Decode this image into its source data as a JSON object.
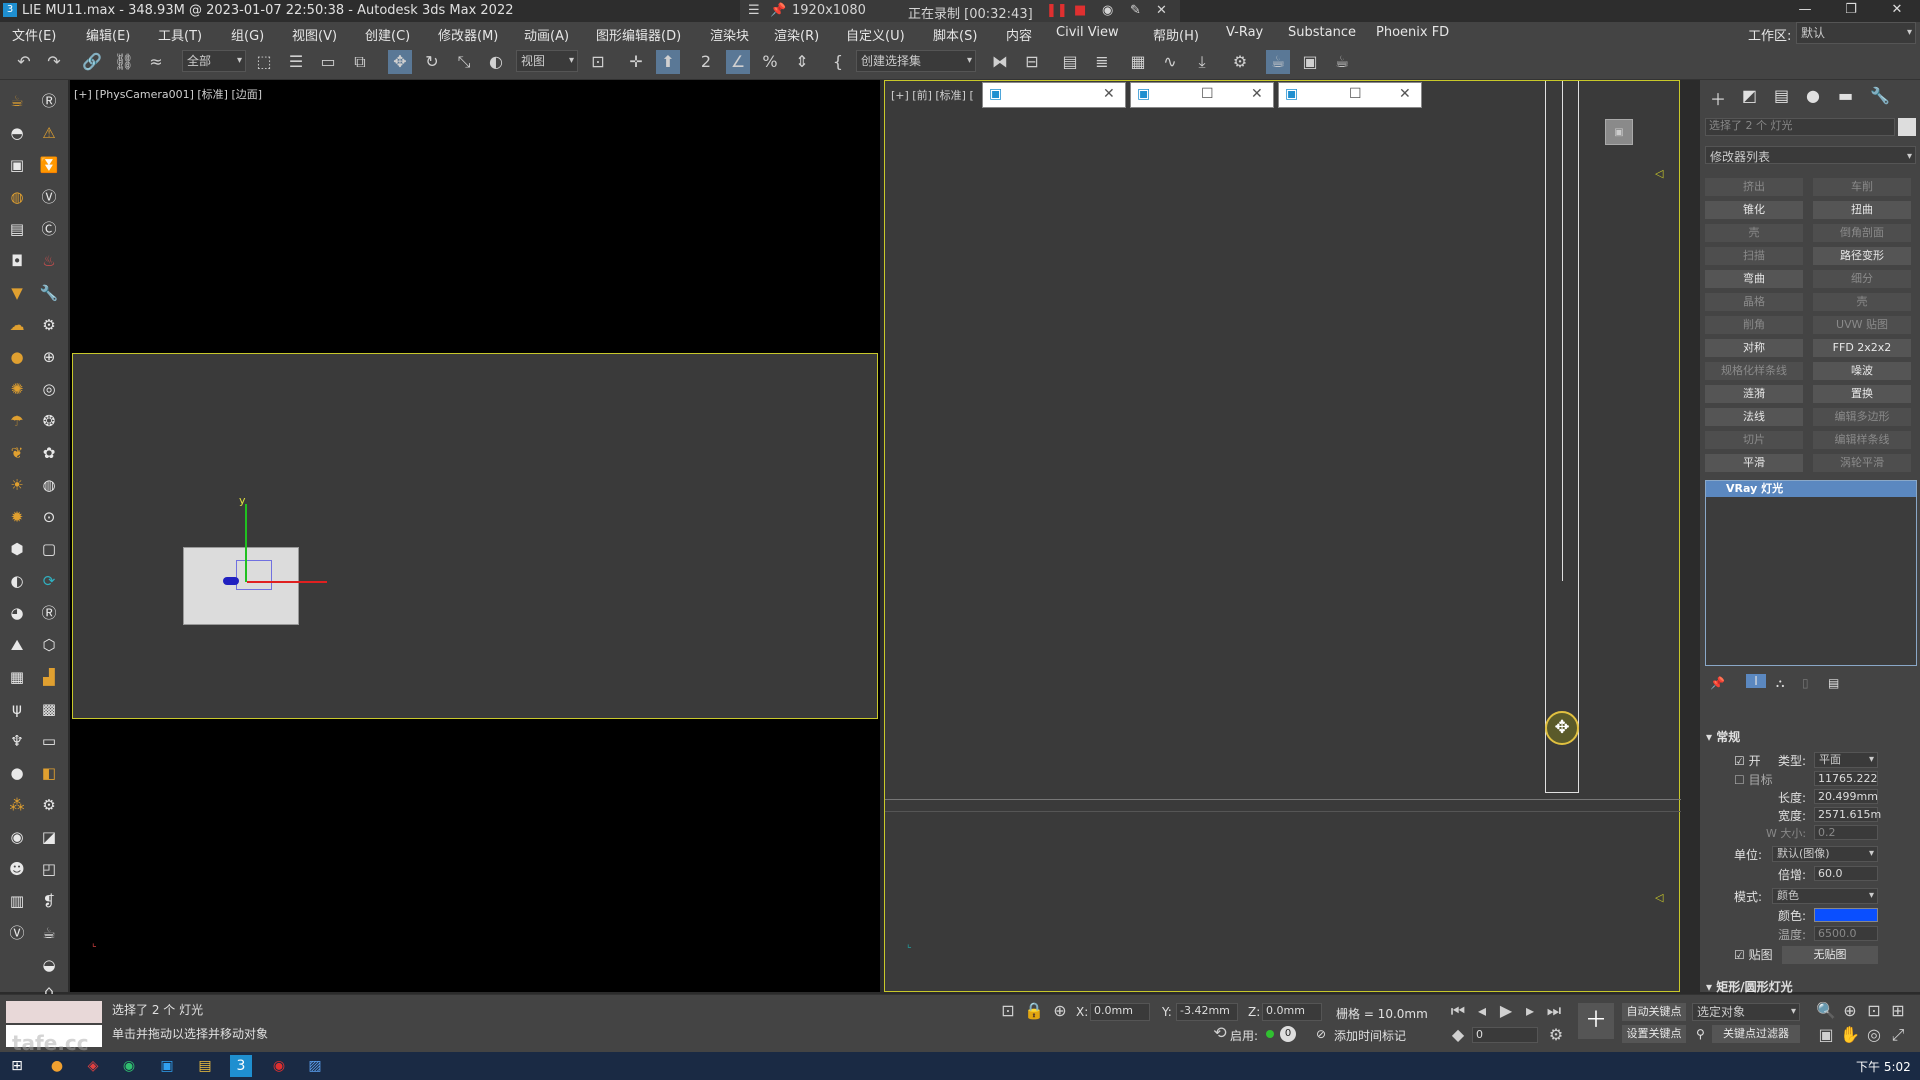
{
  "title": "LIE MU11.max - 348.93M @ 2023-01-07 22:50:38 - Autodesk 3ds Max 2022",
  "recorder": {
    "resolution": "1920x1080",
    "status": "正在录制 [00:32:43]"
  },
  "menu": [
    "文件(E)",
    "编辑(E)",
    "工具(T)",
    "组(G)",
    "视图(V)",
    "创建(C)",
    "修改器(M)",
    "动画(A)",
    "图形编辑器(D)",
    "渲染块",
    "渲染(R)",
    "自定义(U)",
    "脚本(S)",
    "内容",
    "Civil View",
    "帮助(H)",
    "V-Ray",
    "Substance",
    "Phoenix FD"
  ],
  "workspace": {
    "label": "工作区:",
    "value": "默认"
  },
  "toolbar": {
    "filter": "全部",
    "refcoord": "视图",
    "selset": "创建选择集"
  },
  "viewport_left": {
    "label": "[+] [PhysCamera001] [标准] [边面]"
  },
  "viewport_right": {
    "label": "[+] [前] [标准] ["
  },
  "cmd": {
    "selection_name": "选择了 2 个 灯光",
    "modifier_list": "修改器列表",
    "modifiers": [
      [
        "挤出",
        "车削"
      ],
      [
        "锥化",
        "扭曲"
      ],
      [
        "壳",
        "倒角剖面"
      ],
      [
        "扫描",
        "路径变形"
      ],
      [
        "弯曲",
        "细分"
      ],
      [
        "晶格",
        "壳"
      ],
      [
        "削角",
        "UVW 贴图"
      ],
      [
        "对称",
        "FFD 2x2x2"
      ],
      [
        "规格化样条线",
        "噪波"
      ],
      [
        "涟漪",
        "置换"
      ],
      [
        "法线",
        "编辑多边形"
      ],
      [
        "切片",
        "编辑样条线"
      ],
      [
        "平滑",
        "涡轮平滑"
      ]
    ],
    "stack_item": "VRay 灯光",
    "section_general": "常规",
    "on_label": "开",
    "type_label": "类型:",
    "type_value": "平面",
    "target_label": "目标",
    "target_value": "11765.222",
    "length_label": "长度:",
    "length_value": "20.499mm",
    "width_label": "宽度:",
    "width_value": "2571.615m",
    "wsize_label": "W 大小:",
    "wsize_value": "0.2",
    "units_label": "单位:",
    "units_value": "默认(图像)",
    "multiplier_label": "倍增:",
    "multiplier_value": "60.0",
    "mode_label": "模式:",
    "mode_value": "颜色",
    "color_label": "颜色:",
    "light_color": "#0a4fff",
    "temp_label": "温度:",
    "temp_value": "6500.0",
    "texture_label": "贴图",
    "texture_value": "无贴图",
    "section_rect": "矩形/圆形灯光"
  },
  "status": {
    "selected": "选择了 2 个 灯光",
    "hint": "单击并拖动以选择并移动对象",
    "x_label": "X:",
    "x": "0.0mm",
    "y_label": "Y:",
    "y": "-3.42mm",
    "z_label": "Z:",
    "z": "0.0mm",
    "grid": "栅格 = 10.0mm",
    "enable_label": "启用:",
    "enable_value": "0",
    "add_time_tag": "添加时间标记",
    "auto_key": "自动关键点",
    "set_key": "设置关键点",
    "selected_obj": "选定对象",
    "key_filter": "关键点过滤器",
    "frame": "0"
  },
  "clock": "下午 5:02",
  "watermark": "tafe.cc",
  "colors": {
    "selection_border": "#c8c82a",
    "light_color": "#0a4fff"
  }
}
